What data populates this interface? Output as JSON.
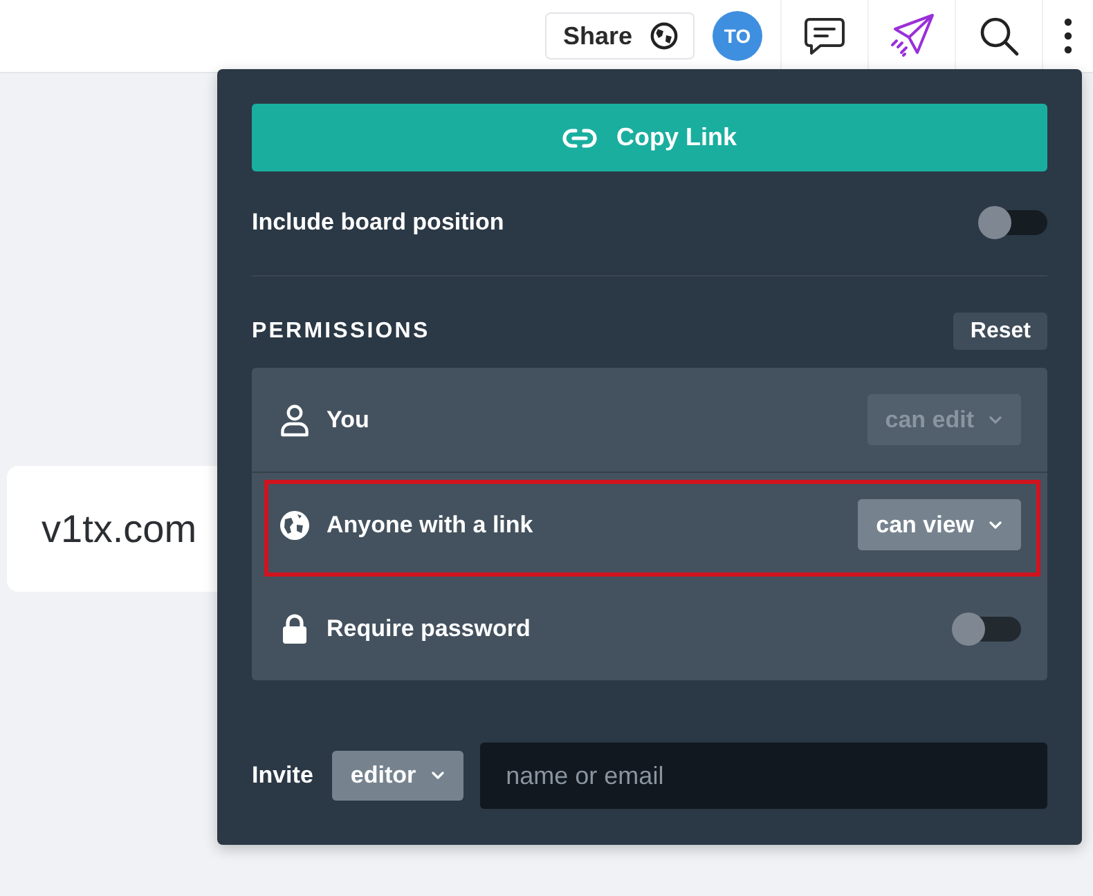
{
  "top_bar": {
    "share_button": {
      "label": "Share"
    },
    "avatar": {
      "initials": "TO"
    }
  },
  "board": {
    "cards": [
      {
        "text": "v1tx.com"
      }
    ]
  },
  "share_panel": {
    "copy_link_button": {
      "label": "Copy Link"
    },
    "include_board_position": {
      "label": "Include board position",
      "on": false
    },
    "permissions": {
      "heading": "PERMISSIONS",
      "reset_button": {
        "label": "Reset"
      },
      "rows": [
        {
          "kind": "owner",
          "label": "You",
          "access": "can edit",
          "disabled": true,
          "highlighted": false
        },
        {
          "kind": "link_access",
          "label": "Anyone with a link",
          "access": "can view",
          "disabled": false,
          "highlighted": true
        },
        {
          "kind": "password",
          "label": "Require password",
          "on": false,
          "highlighted": false
        }
      ]
    },
    "invite": {
      "label": "Invite",
      "role": "editor",
      "placeholder": "name or email"
    }
  }
}
